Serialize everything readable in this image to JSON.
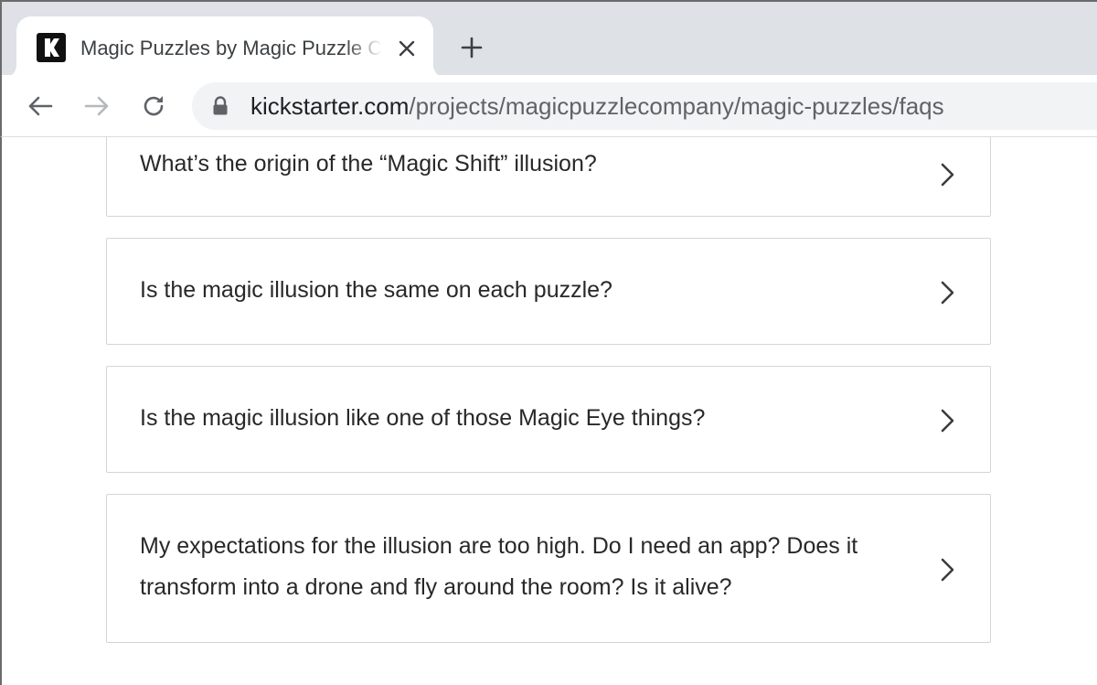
{
  "browser": {
    "tab": {
      "title": "Magic Puzzles by Magic Puzzle Company"
    },
    "address_bar": {
      "host": "kickstarter.com",
      "path": "/projects/magicpuzzlecompany/magic-puzzles/faqs"
    },
    "icons": {
      "favicon": "kickstarter-logo-icon",
      "close": "close-icon",
      "new_tab": "plus-icon",
      "back": "arrow-left-icon",
      "forward": "arrow-right-icon",
      "reload": "reload-icon",
      "lock": "lock-icon"
    }
  },
  "faqs": {
    "items": [
      {
        "question": "What’s the origin of the “Magic Shift” illusion?"
      },
      {
        "question": "Is the magic illusion the same on each puzzle?"
      },
      {
        "question": "Is the magic illusion like one of those Magic Eye things?"
      },
      {
        "question": "My expectations for the illusion are too high. Do I need an app? Does it transform into a drone and fly around the room? Is it alive?"
      }
    ]
  },
  "colors": {
    "tabstrip_bg": "#dee1e6",
    "omnibox_bg": "#f1f3f4",
    "faq_border": "#d5d5d5",
    "text": "#282828"
  }
}
